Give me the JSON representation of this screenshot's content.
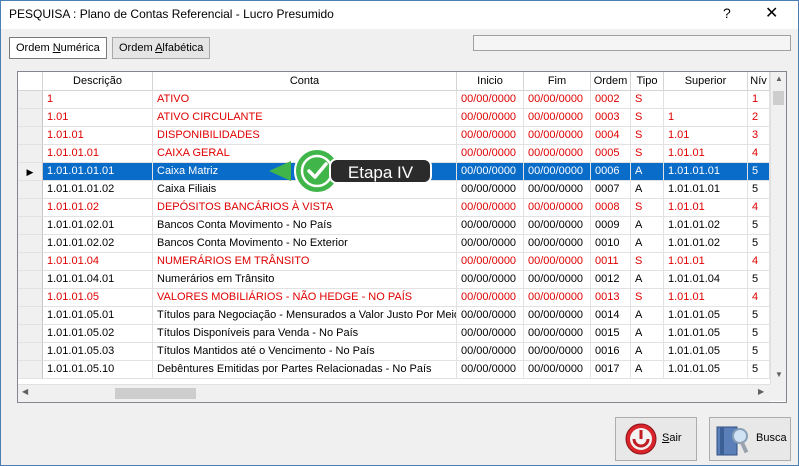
{
  "window": {
    "title": "PESQUISA : Plano de Contas Referencial - Lucro Presumido",
    "help_glyph": "?",
    "close_glyph": "✕"
  },
  "tabs": [
    {
      "pre": "Ordem ",
      "ul": "N",
      "post": "umérica",
      "active": true
    },
    {
      "pre": "Ordem ",
      "ul": "A",
      "post": "lfabética",
      "active": false
    }
  ],
  "grid": {
    "columns": [
      "Descrição",
      "Conta",
      "Inicio",
      "Fim",
      "Ordem",
      "Tipo",
      "Superior",
      "Nív"
    ],
    "rows": [
      {
        "d": "1",
        "c": "ATIVO",
        "i": "00/00/0000",
        "f": "00/00/0000",
        "o": "0002",
        "t": "S",
        "s": "",
        "n": "1",
        "red": true
      },
      {
        "d": "1.01",
        "c": "ATIVO CIRCULANTE",
        "i": "00/00/0000",
        "f": "00/00/0000",
        "o": "0003",
        "t": "S",
        "s": "1",
        "n": "2",
        "red": true
      },
      {
        "d": "1.01.01",
        "c": "DISPONIBILIDADES",
        "i": "00/00/0000",
        "f": "00/00/0000",
        "o": "0004",
        "t": "S",
        "s": "1.01",
        "n": "3",
        "red": true
      },
      {
        "d": "1.01.01.01",
        "c": "CAIXA GERAL",
        "i": "00/00/0000",
        "f": "00/00/0000",
        "o": "0005",
        "t": "S",
        "s": "1.01.01",
        "n": "4",
        "red": true
      },
      {
        "d": "1.01.01.01.01",
        "c": "Caixa Matriz",
        "i": "00/00/0000",
        "f": "00/00/0000",
        "o": "0006",
        "t": "A",
        "s": "1.01.01.01",
        "n": "5",
        "red": false,
        "selected": true
      },
      {
        "d": "1.01.01.01.02",
        "c": "Caixa Filiais",
        "i": "00/00/0000",
        "f": "00/00/0000",
        "o": "0007",
        "t": "A",
        "s": "1.01.01.01",
        "n": "5",
        "red": false
      },
      {
        "d": "1.01.01.02",
        "c": "DEPÓSITOS BANCÁRIOS À VISTA",
        "i": "00/00/0000",
        "f": "00/00/0000",
        "o": "0008",
        "t": "S",
        "s": "1.01.01",
        "n": "4",
        "red": true
      },
      {
        "d": "1.01.01.02.01",
        "c": "Bancos Conta Movimento - No País",
        "i": "00/00/0000",
        "f": "00/00/0000",
        "o": "0009",
        "t": "A",
        "s": "1.01.01.02",
        "n": "5",
        "red": false
      },
      {
        "d": "1.01.01.02.02",
        "c": "Bancos Conta Movimento - No Exterior",
        "i": "00/00/0000",
        "f": "00/00/0000",
        "o": "0010",
        "t": "A",
        "s": "1.01.01.02",
        "n": "5",
        "red": false
      },
      {
        "d": "1.01.01.04",
        "c": "NUMERÁRIOS EM TRÂNSITO",
        "i": "00/00/0000",
        "f": "00/00/0000",
        "o": "0011",
        "t": "S",
        "s": "1.01.01",
        "n": "4",
        "red": true
      },
      {
        "d": "1.01.01.04.01",
        "c": "Numerários em Trânsito",
        "i": "00/00/0000",
        "f": "00/00/0000",
        "o": "0012",
        "t": "A",
        "s": "1.01.01.04",
        "n": "5",
        "red": false
      },
      {
        "d": "1.01.01.05",
        "c": "VALORES MOBILIÁRIOS  - NÃO HEDGE - NO PAÍS",
        "i": "00/00/0000",
        "f": "00/00/0000",
        "o": "0013",
        "t": "S",
        "s": "1.01.01",
        "n": "4",
        "red": true
      },
      {
        "d": "1.01.01.05.01",
        "c": "Títulos para Negociação - Mensurados a Valor Justo Por Meio",
        "i": "00/00/0000",
        "f": "00/00/0000",
        "o": "0014",
        "t": "A",
        "s": "1.01.01.05",
        "n": "5",
        "red": false
      },
      {
        "d": "1.01.01.05.02",
        "c": "Títulos Disponíveis para Venda - No País",
        "i": "00/00/0000",
        "f": "00/00/0000",
        "o": "0015",
        "t": "A",
        "s": "1.01.01.05",
        "n": "5",
        "red": false
      },
      {
        "d": "1.01.01.05.03",
        "c": "Títulos Mantidos até o Vencimento - No País",
        "i": "00/00/0000",
        "f": "00/00/0000",
        "o": "0016",
        "t": "A",
        "s": "1.01.01.05",
        "n": "5",
        "red": false
      },
      {
        "d": "1.01.01.05.10",
        "c": "Debêntures Emitidas por Partes Relacionadas - No País",
        "i": "00/00/0000",
        "f": "00/00/0000",
        "o": "0017",
        "t": "A",
        "s": "1.01.01.05",
        "n": "5",
        "red": false
      }
    ]
  },
  "callout": {
    "label": "Etapa IV",
    "icon": "check-circle-icon",
    "color": "#3fb54a"
  },
  "buttons": {
    "sair": {
      "ul": "S",
      "post": "air",
      "icon": "exit-icon"
    },
    "busca": {
      "label": "Busca",
      "icon": "search-book-icon"
    }
  }
}
